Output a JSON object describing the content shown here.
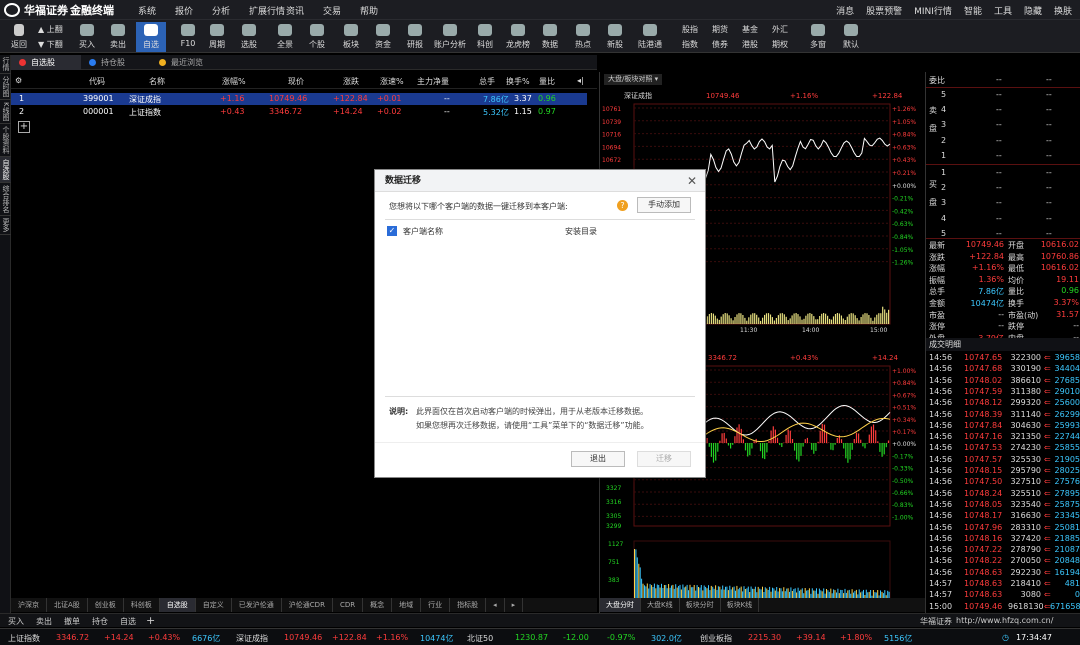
{
  "app": {
    "brand": "华福证券",
    "title": "金融终端"
  },
  "menu": [
    "系统",
    "报价",
    "分析",
    "扩展行情",
    "资讯",
    "交易",
    "帮助"
  ],
  "right_menu": [
    "消息",
    "股票预警",
    "MINI行情",
    "智能",
    "工具",
    "隐藏",
    "换肤"
  ],
  "toolbar": {
    "back": "返回",
    "up": "上翻",
    "down": "下翻",
    "items": [
      "买入",
      "卖出",
      "自选",
      "F10",
      "周期",
      "选股",
      "全景",
      "个股",
      "板块",
      "资金",
      "研报",
      "账户分析",
      "科创",
      "龙虎榜",
      "数据",
      "热点",
      "新股",
      "陆港通"
    ],
    "right_small": [
      [
        "股指",
        "期货",
        "基金",
        "外汇"
      ],
      [
        "指数",
        "债券",
        "港股",
        "期权"
      ]
    ],
    "more": "多窗",
    "default": "默认"
  },
  "left_tabs": [
    "行情",
    "分时图",
    "K线图",
    "个股资料",
    "自选股",
    "综合排名",
    "更多"
  ],
  "top_tabs": [
    "自选股",
    "持仓股",
    "最近浏览"
  ],
  "columns": [
    "代码",
    "名称",
    "涨幅%",
    "现价",
    "涨跌",
    "涨速%",
    "主力净量",
    "总手",
    "换手%",
    "量比"
  ],
  "rows": [
    {
      "no": "1",
      "code": "399001",
      "name": "深证成指",
      "chg_pct": "+1.16",
      "price": "10749.46",
      "chg": "+122.84",
      "speed": "+0.01",
      "net": "--",
      "vol": "7.86亿",
      "turn": "3.37",
      "ratio": "0.96"
    },
    {
      "no": "2",
      "code": "000001",
      "name": "上证指数",
      "chg_pct": "+0.43",
      "price": "3346.72",
      "chg": "+14.24",
      "speed": "+0.02",
      "net": "--",
      "vol": "5.32亿",
      "turn": "1.15",
      "ratio": "0.97"
    }
  ],
  "bottom_tabs": [
    "沪深京",
    "北证A股",
    "创业板",
    "科创板",
    "自选股",
    "自定义",
    "已发沪伦通",
    "沪伦通CDR",
    "CDR",
    "概念",
    "地域",
    "行业",
    "指标股"
  ],
  "status_bar": [
    "买入",
    "卖出",
    "撤单",
    "持仓",
    "自选"
  ],
  "chart": {
    "header_tab": "大盘/板块对照",
    "top": {
      "name": "深证成指",
      "price": "10749.46",
      "pct": "+1.16%",
      "chg": "+122.84",
      "yticks": [
        "10761",
        "10739",
        "10716",
        "10694",
        "10672"
      ],
      "pct_ticks": [
        "+1.26%",
        "+1.05%",
        "+0.84%",
        "+0.63%",
        "+0.43%",
        "+0.21%",
        "+0.00%",
        "-0.21%",
        "-0.42%",
        "-0.63%",
        "-0.84%",
        "-1.05%",
        "-1.26%"
      ],
      "times": [
        "11:30",
        "14:00",
        "15:00"
      ]
    },
    "bottom": {
      "price": "3346.72",
      "pct": "+0.43%",
      "chg": "+14.24",
      "pct_ticks": [
        "+1.00%",
        "+0.84%",
        "+0.67%",
        "+0.51%",
        "+0.34%",
        "+0.17%",
        "+0.00%",
        "-0.17%",
        "-0.33%",
        "-0.50%",
        "-0.66%",
        "-0.83%",
        "-1.00%"
      ],
      "yticks": [
        "3327",
        "3316",
        "3305",
        "3299"
      ],
      "vol_ticks": [
        "1127",
        "751",
        "383"
      ],
      "times": [
        "09:30"
      ]
    },
    "tabs": [
      "大盘分时",
      "大盘K线",
      "板块分时",
      "板块K线"
    ]
  },
  "quote": {
    "weibi": "委比",
    "weibi_val": "--",
    "weicha": "--",
    "sell": "卖盘",
    "buy": "买盘",
    "levels": [
      "5",
      "4",
      "3",
      "2",
      "1",
      "1",
      "2",
      "3",
      "4",
      "5"
    ],
    "stats": [
      [
        "最新",
        "10749.46",
        "开盘",
        "10616.02"
      ],
      [
        "涨跌",
        "+122.84",
        "最高",
        "10760.86"
      ],
      [
        "涨幅",
        "+1.16%",
        "最低",
        "10616.02"
      ],
      [
        "振幅",
        "1.36%",
        "均价",
        "19.11"
      ],
      [
        "总手",
        "7.86亿",
        "量比",
        "0.96"
      ],
      [
        "金额",
        "10474亿",
        "换手",
        "3.37%"
      ],
      [
        "市盈",
        "--",
        "市盈(动)",
        "31.57"
      ],
      [
        "涨停",
        "--",
        "跌停",
        "--"
      ],
      [
        "外盘",
        "3.79亿",
        "内盘",
        "--"
      ]
    ],
    "trades_title": "成交明细",
    "trades": [
      [
        "14:56",
        "10747.65",
        "322300",
        "39658"
      ],
      [
        "14:56",
        "10747.68",
        "330190",
        "34404"
      ],
      [
        "14:56",
        "10748.02",
        "386610",
        "27685"
      ],
      [
        "14:56",
        "10747.59",
        "311380",
        "29010"
      ],
      [
        "14:56",
        "10748.12",
        "299320",
        "25600"
      ],
      [
        "14:56",
        "10748.39",
        "311140",
        "26299"
      ],
      [
        "14:56",
        "10747.84",
        "304630",
        "25993"
      ],
      [
        "14:56",
        "10747.16",
        "321350",
        "22744"
      ],
      [
        "14:56",
        "10747.53",
        "274230",
        "25855"
      ],
      [
        "14:56",
        "10747.57",
        "325530",
        "21905"
      ],
      [
        "14:56",
        "10748.15",
        "295790",
        "28025"
      ],
      [
        "14:56",
        "10747.50",
        "327510",
        "27576"
      ],
      [
        "14:56",
        "10748.24",
        "325510",
        "27895"
      ],
      [
        "14:56",
        "10748.05",
        "323540",
        "25875"
      ],
      [
        "14:56",
        "10748.17",
        "316630",
        "23345"
      ],
      [
        "14:56",
        "10747.96",
        "283310",
        "25081"
      ],
      [
        "14:56",
        "10748.16",
        "327420",
        "21885"
      ],
      [
        "14:56",
        "10747.22",
        "278790",
        "21087"
      ],
      [
        "14:56",
        "10748.22",
        "270050",
        "20848"
      ],
      [
        "14:56",
        "10748.63",
        "292230",
        "16194"
      ],
      [
        "14:57",
        "10748.63",
        "218410",
        "481"
      ],
      [
        "14:57",
        "10748.63",
        "3080",
        "0"
      ],
      [
        "15:00",
        "10749.46",
        "9618130",
        "671658"
      ]
    ],
    "footer_brand": "华福证券",
    "footer_url": "http://www.hfzq.com.cn/"
  },
  "index_bar": [
    {
      "name": "上证指数",
      "price": "3346.72",
      "chg": "+14.24",
      "pct": "+0.43%",
      "amt": "6676亿"
    },
    {
      "name": "深证成指",
      "price": "10749.46",
      "chg": "+122.84",
      "pct": "+1.16%",
      "amt": "10474亿"
    },
    {
      "name": "北证50",
      "price": "1230.87",
      "chg": "-12.00",
      "pct": "-0.97%",
      "amt": "302.0亿"
    },
    {
      "name": "创业板指",
      "price": "2215.30",
      "chg": "+39.14",
      "pct": "+1.80%",
      "amt": "5156亿"
    }
  ],
  "clock": "17:34:47",
  "dialog": {
    "title": "数据迁移",
    "prompt": "您想将以下哪个客户端的数据一键迁移到本客户端:",
    "manual_btn": "手动添加",
    "col_name": "客户端名称",
    "col_dir": "安装目录",
    "note_label": "说明:",
    "note1": "此界面仅在首次启动客户端的时候弹出，用于从老版本迁移数据。",
    "note2": "如果您想再次迁移数据，请使用“工具”菜单下的“数据迁移”功能。",
    "exit_btn": "退出",
    "migrate_btn": "迁移"
  },
  "colors": {
    "up": "#ff3c3c",
    "down": "#23d723",
    "accent": "#2c63b6",
    "bg": "#000000"
  }
}
